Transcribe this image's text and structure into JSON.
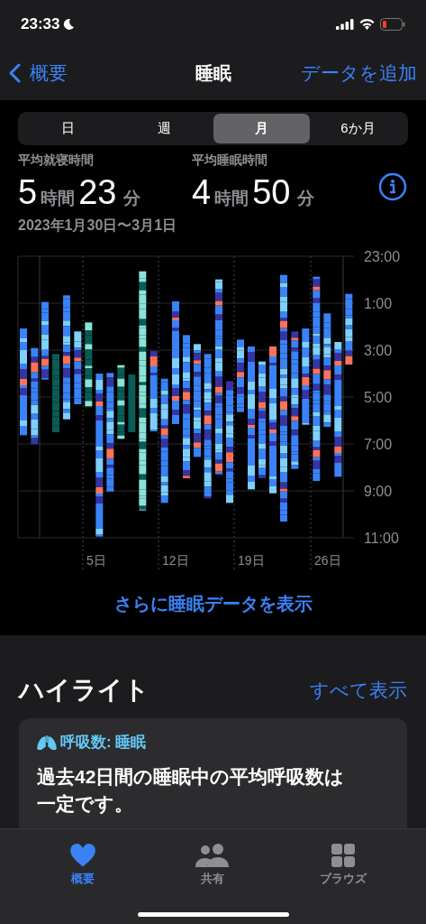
{
  "status_bar": {
    "time": "23:33"
  },
  "nav": {
    "back": "概要",
    "title": "睡眠",
    "action": "データを追加"
  },
  "tabs": [
    {
      "label": "日",
      "selected": false
    },
    {
      "label": "週",
      "selected": false
    },
    {
      "label": "月",
      "selected": true
    },
    {
      "label": "6か月",
      "selected": false
    }
  ],
  "stats": [
    {
      "label": "平均就寝時間",
      "hours": "5",
      "hours_unit": "時間",
      "minutes": "23",
      "minutes_unit": "分"
    },
    {
      "label": "平均睡眠時間",
      "hours": "4",
      "hours_unit": "時間",
      "minutes": "50",
      "minutes_unit": "分"
    }
  ],
  "date_range": "2023年1月30日〜3月1日",
  "chart": {
    "y_ticks": [
      "23:00",
      "1:00",
      "3:00",
      "5:00",
      "7:00",
      "9:00",
      "11:00"
    ],
    "x_ticks": [
      "5日",
      "12日",
      "19日",
      "26日"
    ]
  },
  "more_link": "さらに睡眠データを表示",
  "highlights": {
    "title": "ハイライト",
    "see_all": "すべて表示",
    "card": {
      "title": "呼吸数: 睡眠",
      "body": "過去42日間の睡眠中の平均呼吸数は一定です。"
    }
  },
  "tab_bar": [
    {
      "label": "概要",
      "selected": true
    },
    {
      "label": "共有",
      "selected": false
    },
    {
      "label": "ブラウズ",
      "selected": false
    }
  ]
}
